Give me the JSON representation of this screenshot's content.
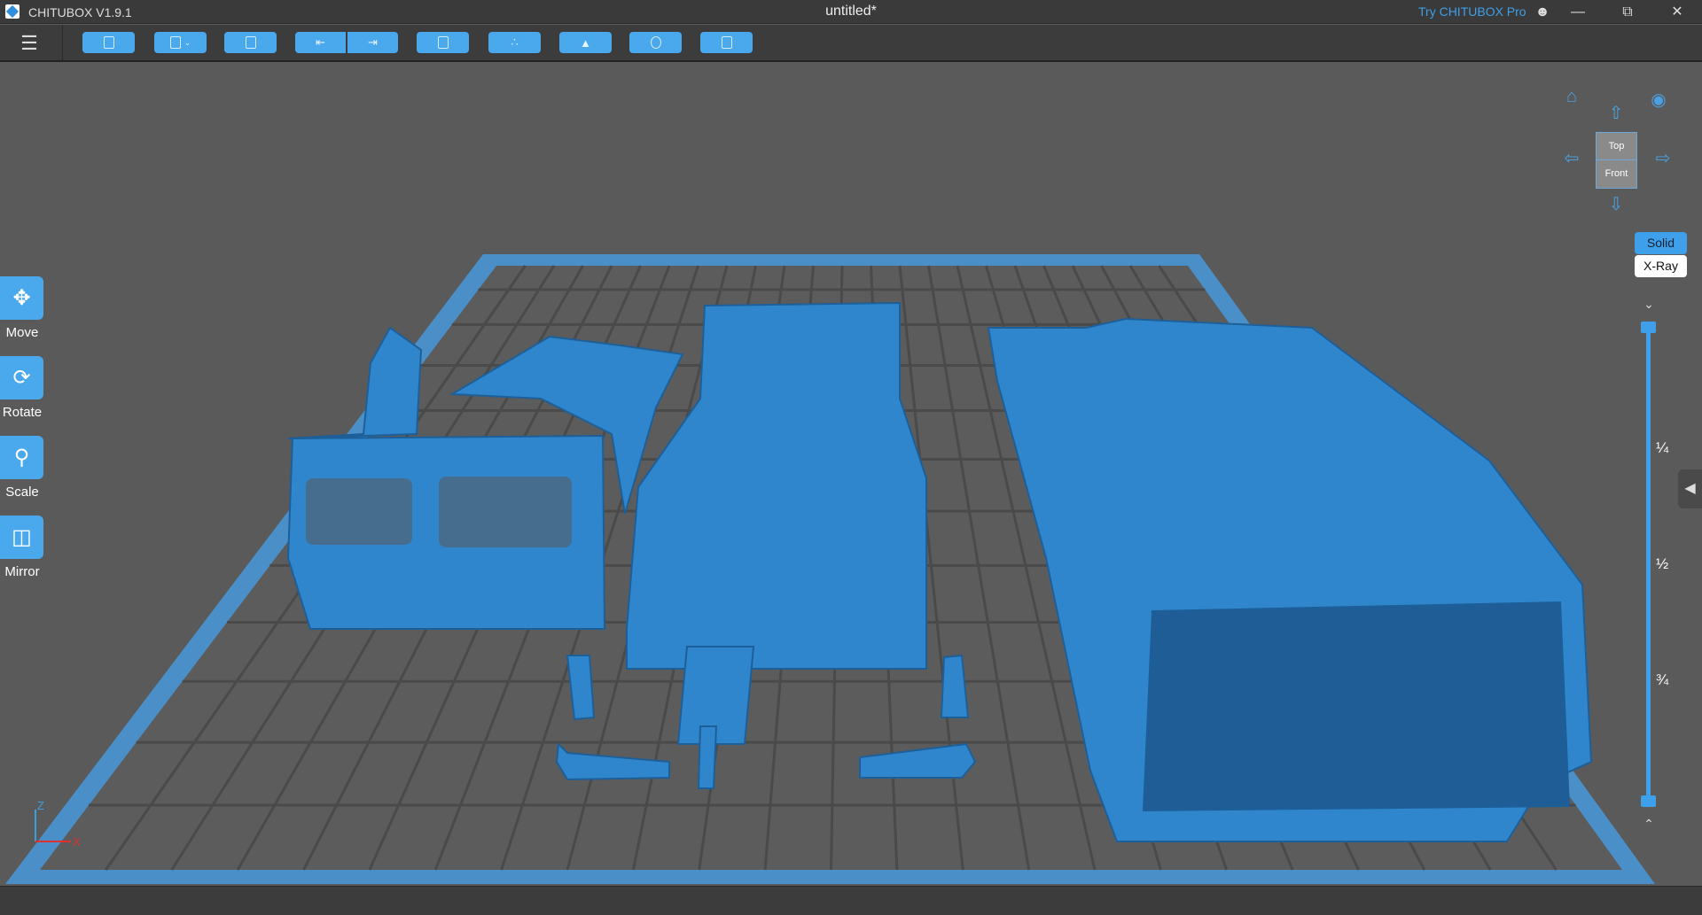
{
  "titlebar": {
    "app_name": "CHITUBOX V1.9.1",
    "document_title": "untitled*",
    "try_pro": "Try CHITUBOX Pro"
  },
  "toolbar": {
    "buttons": [
      "open-file",
      "save",
      "auto-arrange",
      "undo",
      "redo",
      "slice-settings",
      "auto-layout",
      "add-supports",
      "hollow",
      "print-slice"
    ]
  },
  "left_tools": [
    {
      "label": "Move",
      "icon": "move-icon"
    },
    {
      "label": "Rotate",
      "icon": "rotate-icon"
    },
    {
      "label": "Scale",
      "icon": "scale-icon"
    },
    {
      "label": "Mirror",
      "icon": "mirror-icon"
    }
  ],
  "view_cube": {
    "top": "Top",
    "front": "Front"
  },
  "render_modes": {
    "solid": "Solid",
    "xray": "X-Ray",
    "active": "Solid"
  },
  "layer_slider": {
    "marks": [
      "¼",
      "½",
      "¾"
    ],
    "low": 0,
    "high": 1
  },
  "axes": {
    "z": "Z",
    "x": "X"
  },
  "colors": {
    "accent": "#3ea0ea",
    "model": "#2f86cc",
    "plate": "#4a8fc7"
  }
}
